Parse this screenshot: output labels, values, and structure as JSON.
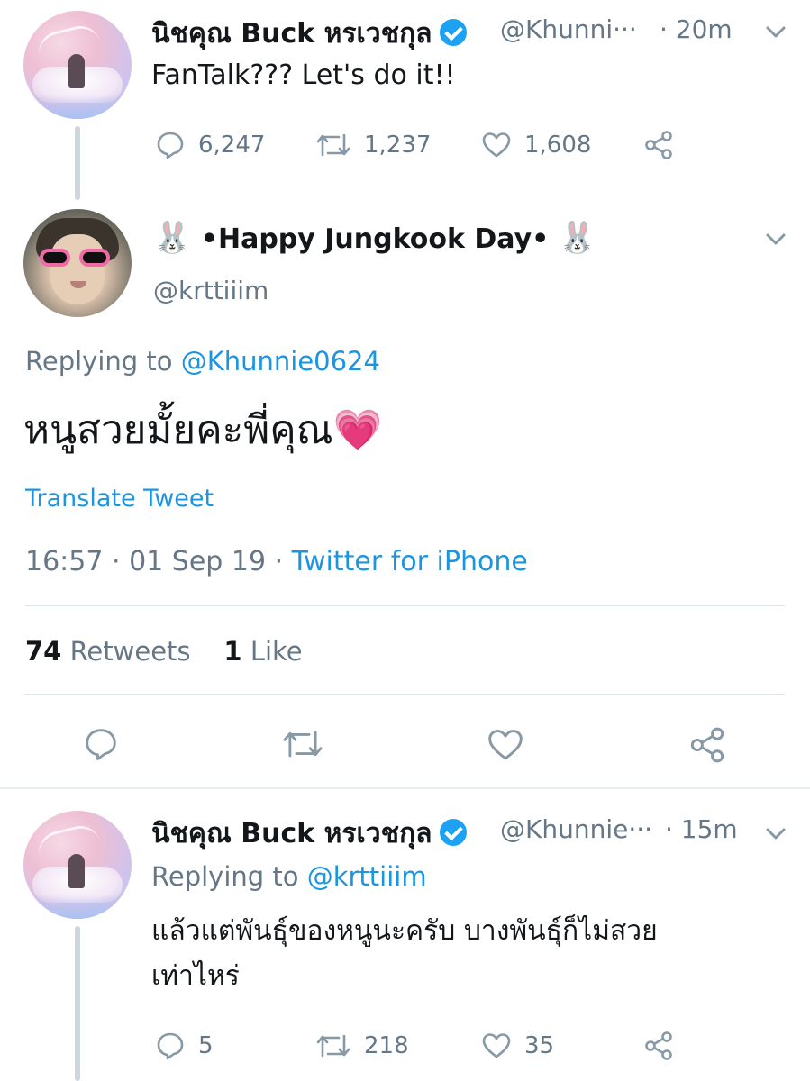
{
  "tweet1": {
    "name": "นิชคุณ Buck หรเวชกุล",
    "handle": "@Khunni···",
    "time": "· 20m",
    "text": "FanTalk??? Let's do it!!",
    "replies": "6,247",
    "retweets": "1,237",
    "likes": "1,608"
  },
  "tweet2": {
    "bunny_left": "🐰",
    "name": "•Happy Jungkook Day•",
    "bunny_right": "🐰",
    "handle": "@krttiiim",
    "replying_prefix": "Replying to",
    "replying_handle": "@Khunnie0624",
    "text": "หนูสวยมั้ยคะพี่คุณ",
    "emoji": "💗",
    "translate": "Translate Tweet",
    "timestamp": "16:57 · 01 Sep 19 ·",
    "source": "Twitter for iPhone",
    "retweets_num": "74",
    "retweets_label": "Retweets",
    "likes_num": "1",
    "likes_label": "Like"
  },
  "tweet3": {
    "name": "นิชคุณ Buck หรเวชกุล",
    "handle": "@Khunnie···",
    "time": "· 15m",
    "replying_prefix": "Replying to",
    "replying_handle": "@krttiiim",
    "text_line1": "แล้วแต่พันธุ์ของหนูนะครับ บางพันธุ์ก็ไม่สวย",
    "text_line2": "เท่าไหร่",
    "replies": "5",
    "retweets": "218",
    "likes": "35"
  },
  "colors": {
    "accent": "#1b95e0",
    "verified": "#1da1f2",
    "muted": "#657786",
    "text": "#14171a"
  }
}
